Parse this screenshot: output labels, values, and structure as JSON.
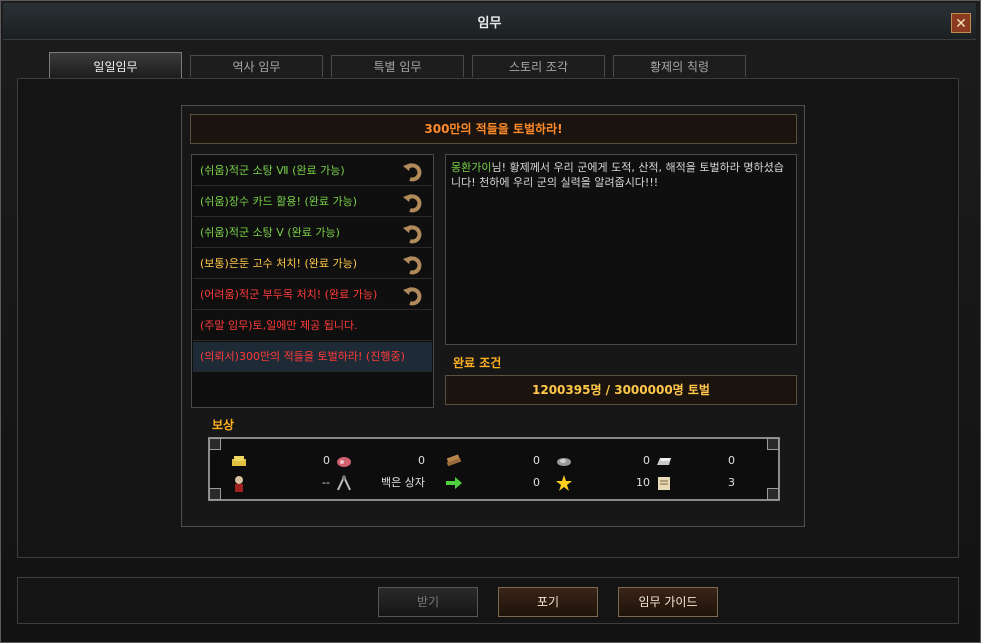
{
  "window": {
    "title": "임무",
    "close_glyph": "✕"
  },
  "tabs": [
    {
      "label": "일일임무",
      "active": true
    },
    {
      "label": "역사 임무",
      "active": false
    },
    {
      "label": "특별 임무",
      "active": false
    },
    {
      "label": "스토리 조각",
      "active": false
    },
    {
      "label": "황제의 칙령",
      "active": false
    }
  ],
  "quest": {
    "title": "300만의 적들을 토벌하라!",
    "list": [
      {
        "text": "(쉬움)적군 소탕 Ⅶ (완료 가능)",
        "color": "#78d04a",
        "undo": true
      },
      {
        "text": "(쉬움)장수 카드 활용! (완료 가능)",
        "color": "#78d04a",
        "undo": true
      },
      {
        "text": "(쉬움)적군 소탕 Ⅴ (완료 가능)",
        "color": "#78d04a",
        "undo": true
      },
      {
        "text": "(보통)은둔 고수 처치! (완료 가능)",
        "color": "#ffc84a",
        "undo": true
      },
      {
        "text": "(어려움)적군 부두목 처치! (완료 가능)",
        "color": "#ff3a3a",
        "undo": true
      },
      {
        "text": "(주말 임무)토,일에만 제공 됩니다.",
        "color": "#ff3a3a",
        "undo": false
      },
      {
        "text": "(의뢰서)300만의 적들을 토벌하라! (진행중)",
        "color": "#ff3a3a",
        "undo": false,
        "selected": true
      }
    ],
    "description_name": "몽환가이",
    "description_text": "님! 황제께서 우리 군에게 도적, 산적, 해적을 토벌하라 명하셨습니다! 천하에 우리 군의 실력을 알려줍시다!!!",
    "condition_label": "완료 조건",
    "condition_value": "1200395명 / 3000000명 토벌"
  },
  "reward": {
    "label": "보상",
    "row1": [
      {
        "icon": "gold-icon",
        "value": "0"
      },
      {
        "icon": "meat-icon",
        "value": "0"
      },
      {
        "icon": "wood-icon",
        "value": "0"
      },
      {
        "icon": "ore-icon",
        "value": "0"
      },
      {
        "icon": "silver-ingot-icon",
        "value": "0"
      }
    ],
    "row2": [
      {
        "icon": "general-icon",
        "value": "--"
      },
      {
        "icon": "box-icon",
        "value": "백은 상자"
      },
      {
        "icon": "arrow-icon",
        "value": "0"
      },
      {
        "icon": "stars-icon",
        "value": "10"
      },
      {
        "icon": "scroll-icon",
        "value": "3"
      }
    ]
  },
  "buttons": {
    "receive": "받기",
    "give_up": "포기",
    "guide": "임무 가이드"
  }
}
